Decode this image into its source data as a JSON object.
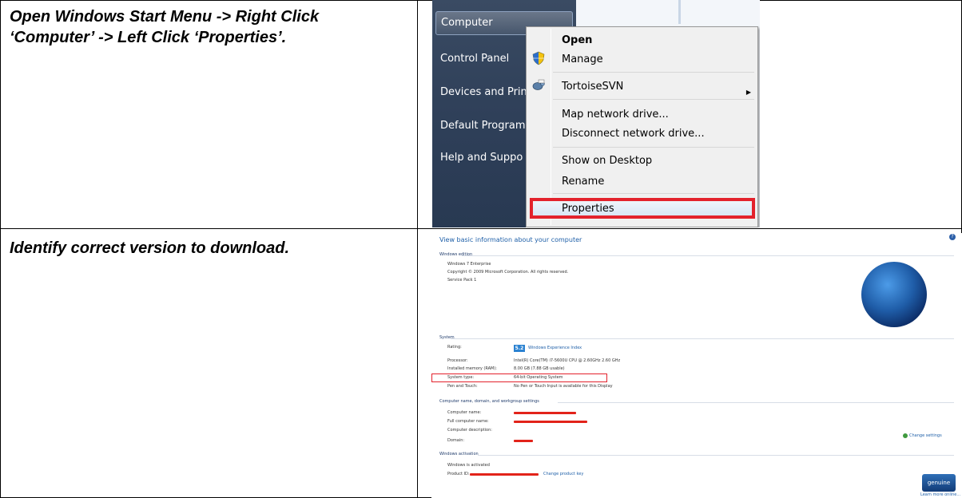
{
  "rows": [
    {
      "instruction": "Open Windows Start Menu -> Right Click ‘Computer’ -> Left Click ‘Properties’."
    },
    {
      "instruction": "Identify correct version to download."
    }
  ],
  "start_menu": {
    "items": [
      "Computer",
      "Control Panel",
      "Devices and Prin",
      "Default Program",
      "Help and Suppo"
    ]
  },
  "context_menu": {
    "items": [
      "Open",
      "Manage",
      "TortoiseSVN",
      "Map network drive...",
      "Disconnect network drive...",
      "Show on Desktop",
      "Rename",
      "Properties"
    ],
    "highlight_color": "#e3222c"
  },
  "system_properties": {
    "title": "View basic information about your computer",
    "windows_edition": {
      "heading": "Windows edition",
      "edition": "Windows 7 Enterprise",
      "copyright": "Copyright © 2009 Microsoft Corporation.  All rights reserved.",
      "service_pack": "Service Pack 1"
    },
    "system": {
      "heading": "System",
      "rating_label": "Rating:",
      "rating_value": "5.2",
      "rating_link": "Windows Experience Index",
      "processor_label": "Processor:",
      "processor_value": "Intel(R) Core(TM) i7-5600U CPU @ 2.60GHz   2.60 GHz",
      "memory_label": "Installed memory (RAM):",
      "memory_value": "8.00 GB (7.88 GB usable)",
      "system_type_label": "System type:",
      "system_type_value": "64-bit Operating System",
      "pen_label": "Pen and Touch:",
      "pen_value": "No Pen or Touch Input is available for this Display"
    },
    "computer_name": {
      "heading": "Computer name, domain, and workgroup settings",
      "computer_name_label": "Computer name:",
      "full_name_label": "Full computer name:",
      "description_label": "Computer description:",
      "domain_label": "Domain:",
      "change_settings": "Change settings"
    },
    "activation": {
      "heading": "Windows activation",
      "status": "Windows is activated",
      "product_id_label": "Product ID:",
      "change_key": "Change product key",
      "genuine": "genuine",
      "learn_more": "Learn more online..."
    },
    "redaction_color": "#e2231a"
  }
}
